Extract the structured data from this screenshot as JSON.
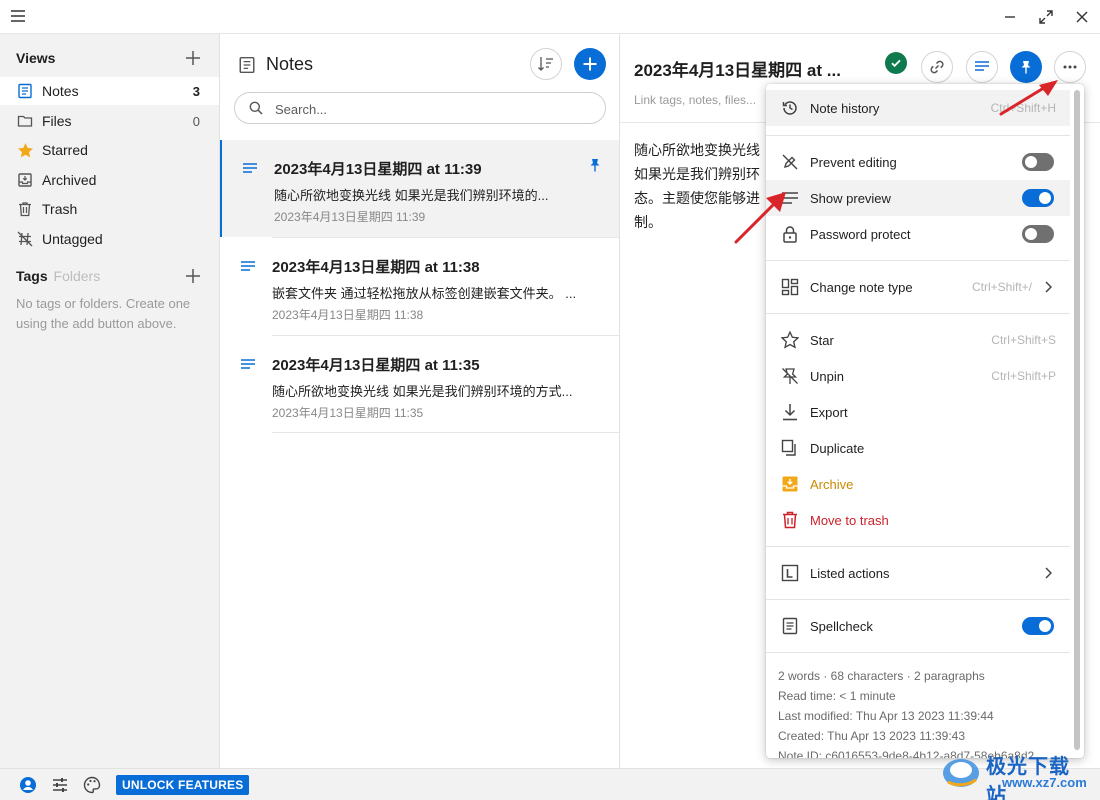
{
  "sidebar": {
    "views_label": "Views",
    "items": [
      {
        "label": "Notes",
        "count": "3",
        "icon": "notes-icon"
      },
      {
        "label": "Files",
        "count": "0",
        "icon": "folder-icon"
      },
      {
        "label": "Starred",
        "count": "",
        "icon": "star-icon"
      },
      {
        "label": "Archived",
        "count": "",
        "icon": "archive-icon"
      },
      {
        "label": "Trash",
        "count": "",
        "icon": "trash-icon"
      },
      {
        "label": "Untagged",
        "count": "",
        "icon": "untagged-icon"
      }
    ],
    "tags_label": "Tags",
    "folders_label": "Folders",
    "tags_empty": "No tags or folders. Create one using the add button above."
  },
  "bottombar": {
    "unlock_label": "UNLOCK FEATURES"
  },
  "notes_list": {
    "title": "Notes",
    "search_placeholder": "Search...",
    "notes": [
      {
        "title": "2023年4月13日星期四 at 11:39",
        "preview": "随心所欲地变换光线 如果光是我们辨别环境的...",
        "date": "2023年4月13日星期四 11:39",
        "pinned": true
      },
      {
        "title": "2023年4月13日星期四 at 11:38",
        "preview": "嵌套文件夹 通过轻松拖放从标签创建嵌套文件夹。 ...",
        "date": "2023年4月13日星期四 11:38",
        "pinned": false
      },
      {
        "title": "2023年4月13日星期四 at 11:35",
        "preview": "随心所欲地变换光线 如果光是我们辨别环境的方式...",
        "date": "2023年4月13日星期四 11:35",
        "pinned": false
      }
    ]
  },
  "editor": {
    "title": "2023年4月13日星期四 at ...",
    "tags_placeholder": "Link tags, notes, files...",
    "body_lines": [
      "随心所欲地变换光线",
      "如果光是我们辨别环",
      "态。主题使您能够进",
      "制。"
    ]
  },
  "menu": {
    "note_history": {
      "label": "Note history",
      "shortcut": "Ctrl+Shift+H"
    },
    "prevent_editing": {
      "label": "Prevent editing",
      "on": false
    },
    "show_preview": {
      "label": "Show preview",
      "on": true
    },
    "password_protect": {
      "label": "Password protect",
      "on": false
    },
    "change_note_type": {
      "label": "Change note type",
      "shortcut": "Ctrl+Shift+/"
    },
    "star": {
      "label": "Star",
      "shortcut": "Ctrl+Shift+S"
    },
    "unpin": {
      "label": "Unpin",
      "shortcut": "Ctrl+Shift+P"
    },
    "export": {
      "label": "Export"
    },
    "duplicate": {
      "label": "Duplicate"
    },
    "archive": {
      "label": "Archive"
    },
    "move_to_trash": {
      "label": "Move to trash"
    },
    "listed_actions": {
      "label": "Listed actions"
    },
    "spellcheck": {
      "label": "Spellcheck",
      "on": true
    },
    "stats": {
      "words": "2 words · 68 characters · 2 paragraphs",
      "read_time": "Read time: < 1 minute",
      "last_modified": "Last modified: Thu Apr 13 2023 11:39:44",
      "created": "Created: Thu Apr 13 2023 11:39:43",
      "note_id": "Note ID: c6016553-9de8-4b12-a8d7-58eb6a8d2..."
    }
  },
  "watermark": {
    "line1": "极光下载站",
    "line2": "www.xz7.com"
  },
  "colors": {
    "accent": "#086dd6",
    "success": "#0f7a4d",
    "warning": "#c98a00",
    "danger": "#cc2128",
    "annotation_arrow": "#d9252a"
  }
}
